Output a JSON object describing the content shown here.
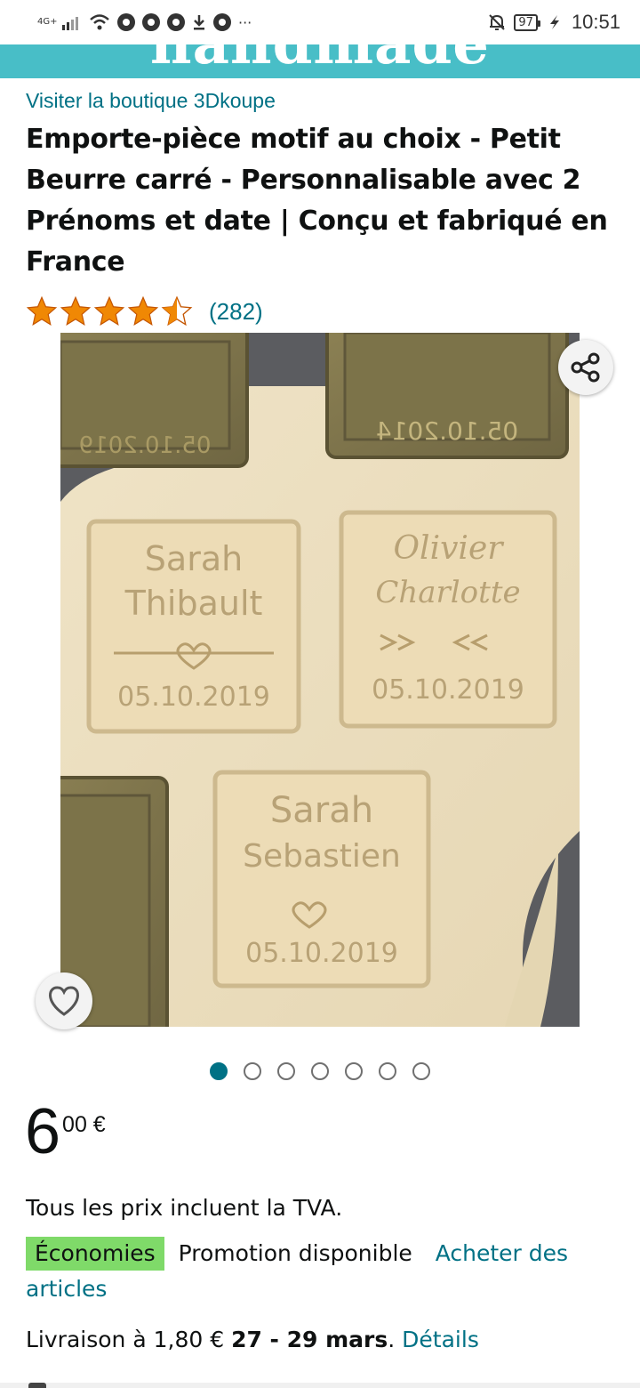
{
  "status_bar": {
    "network": "4G+",
    "battery": "97",
    "time": "10:51",
    "more": "···"
  },
  "banner": {
    "text": "handmade"
  },
  "product": {
    "store_link": "Visiter la boutique 3Dkoupe",
    "title": "Emporte-pièce motif au choix - Petit Beurre carré - Personnalisable avec 2 Prénoms et date | Conçu et fabriqué en France",
    "rating_stars": 4.5,
    "rating_count": "(282)"
  },
  "gallery": {
    "image_count": 7,
    "active_index": 0,
    "cookies": [
      {
        "line1": "Sarah",
        "line2": "Thibault",
        "date": "05.10.2019"
      },
      {
        "line1": "Olivier",
        "line2": "Charlotte",
        "date": "05.10.2019"
      },
      {
        "line1": "Sarah",
        "line2": "Sebastien",
        "date": "05.10.2019"
      }
    ],
    "cutters_text": {
      "top_left_date": "05.10.2019",
      "top_right_date": "05.10.2014"
    }
  },
  "price": {
    "whole": "6",
    "fraction": "00 €"
  },
  "vat_note": "Tous les prix incluent la TVA.",
  "promo": {
    "badge": "Économies",
    "text": "Promotion disponible",
    "link": "Acheter des articles"
  },
  "delivery": {
    "prefix": "Livraison à 1,80 €",
    "dates": "27 - 29 mars",
    "suffix": ".",
    "link": "Détails"
  },
  "colors": {
    "link": "#007185",
    "banner": "#48bec7",
    "badge": "#7fda69",
    "star": "#f08804"
  }
}
